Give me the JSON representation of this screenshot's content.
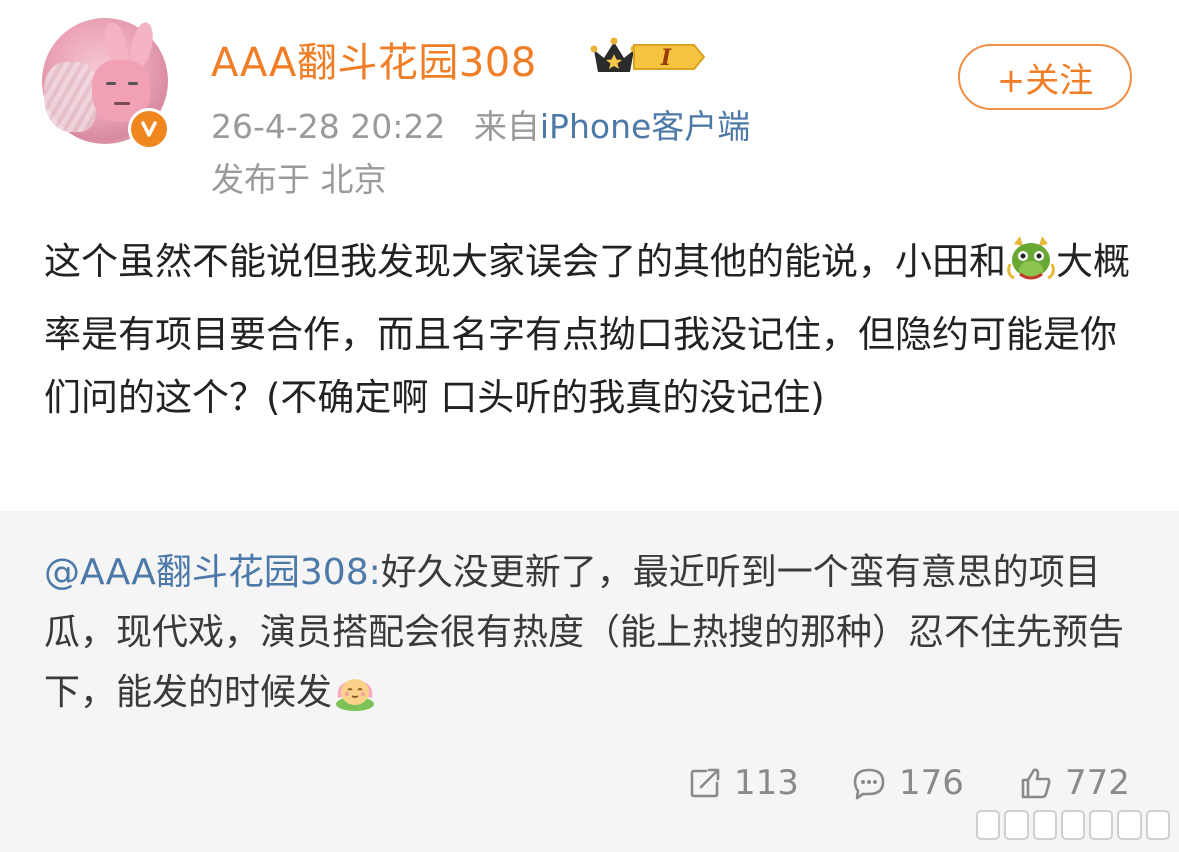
{
  "post": {
    "username": "AAA翻斗花园308",
    "badge_level": "I",
    "date": "26-4-28 20:22",
    "source_prefix": "来自",
    "source_client": "iPhone客户端",
    "location": "发布于 北京",
    "follow_label": "+关注",
    "text_part1": "这个虽然不能说但我发现大家误会了的其他的能说，小田和",
    "text_part2": "大概率是有项目要合作，而且名字有点拗口我没记住，但隐约可能是你们问的这个？(不确定啊 口头听的我真的没记住)"
  },
  "quote": {
    "mention": "@AAA翻斗花园308:",
    "text": "好久没更新了，最近听到一个蛮有意思的项目瓜，现代戏，演员搭配会很有热度（能上热搜的那种）忍不住先预告下，能发的时候发"
  },
  "stats": {
    "reposts": "113",
    "comments": "176",
    "likes": "772"
  },
  "colors": {
    "username": "#f07e27",
    "link": "#4d79a8",
    "meta": "#9a9a9a",
    "quote_bg": "#f5f5f5"
  },
  "icons": {
    "verified": "verified-badge-icon",
    "crown": "crown-icon",
    "dragon": "dragon-emoji-icon",
    "lotus": "lotus-emoji-icon",
    "repost": "repost-icon",
    "comment": "comment-icon",
    "like": "like-icon"
  }
}
